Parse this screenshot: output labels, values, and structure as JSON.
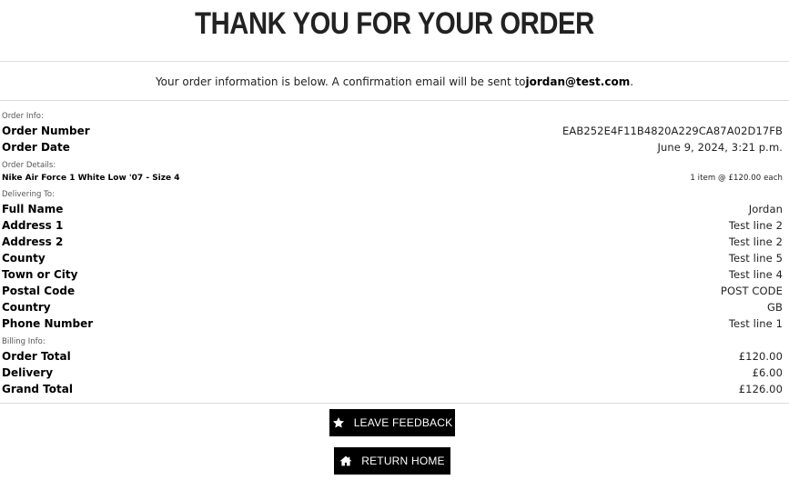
{
  "page": {
    "title": "THANK YOU FOR YOUR ORDER",
    "intro_text": "Your order information is below. A confirmation email will be sent to",
    "email": "jordan@test.com",
    "intro_suffix": "."
  },
  "order_info": {
    "section_label": "Order Info:",
    "order_number_label": "Order Number",
    "order_number": "EAB252E4F11B4820A229CA87A02D17FB",
    "order_date_label": "Order Date",
    "order_date": "June 9, 2024, 3:21 p.m."
  },
  "order_details": {
    "section_label": "Order Details:",
    "item_name": "Nike Air Force 1 White Low '07 - Size 4",
    "item_qty": "1 item @ £120.00 each"
  },
  "delivering_to": {
    "section_label": "Delivering To:",
    "fields": [
      {
        "label": "Full Name",
        "value": "Jordan"
      },
      {
        "label": "Address 1",
        "value": "Test line 2"
      },
      {
        "label": "Address 2",
        "value": "Test line 2"
      },
      {
        "label": "County",
        "value": "Test line 5"
      },
      {
        "label": "Town or City",
        "value": "Test line 4"
      },
      {
        "label": "Postal Code",
        "value": "POST CODE"
      },
      {
        "label": "Country",
        "value": "GB"
      },
      {
        "label": "Phone Number",
        "value": "Test line 1"
      }
    ]
  },
  "billing_info": {
    "section_label": "Billing Info:",
    "fields": [
      {
        "label": "Order Total",
        "value": "£120.00"
      },
      {
        "label": "Delivery",
        "value": "£6.00"
      },
      {
        "label": "Grand Total",
        "value": "£126.00"
      }
    ]
  },
  "buttons": {
    "feedback_label": "Leave Feedback",
    "feedback_icon": "star-icon",
    "home_label": "Return Home",
    "home_icon": "home-icon"
  }
}
